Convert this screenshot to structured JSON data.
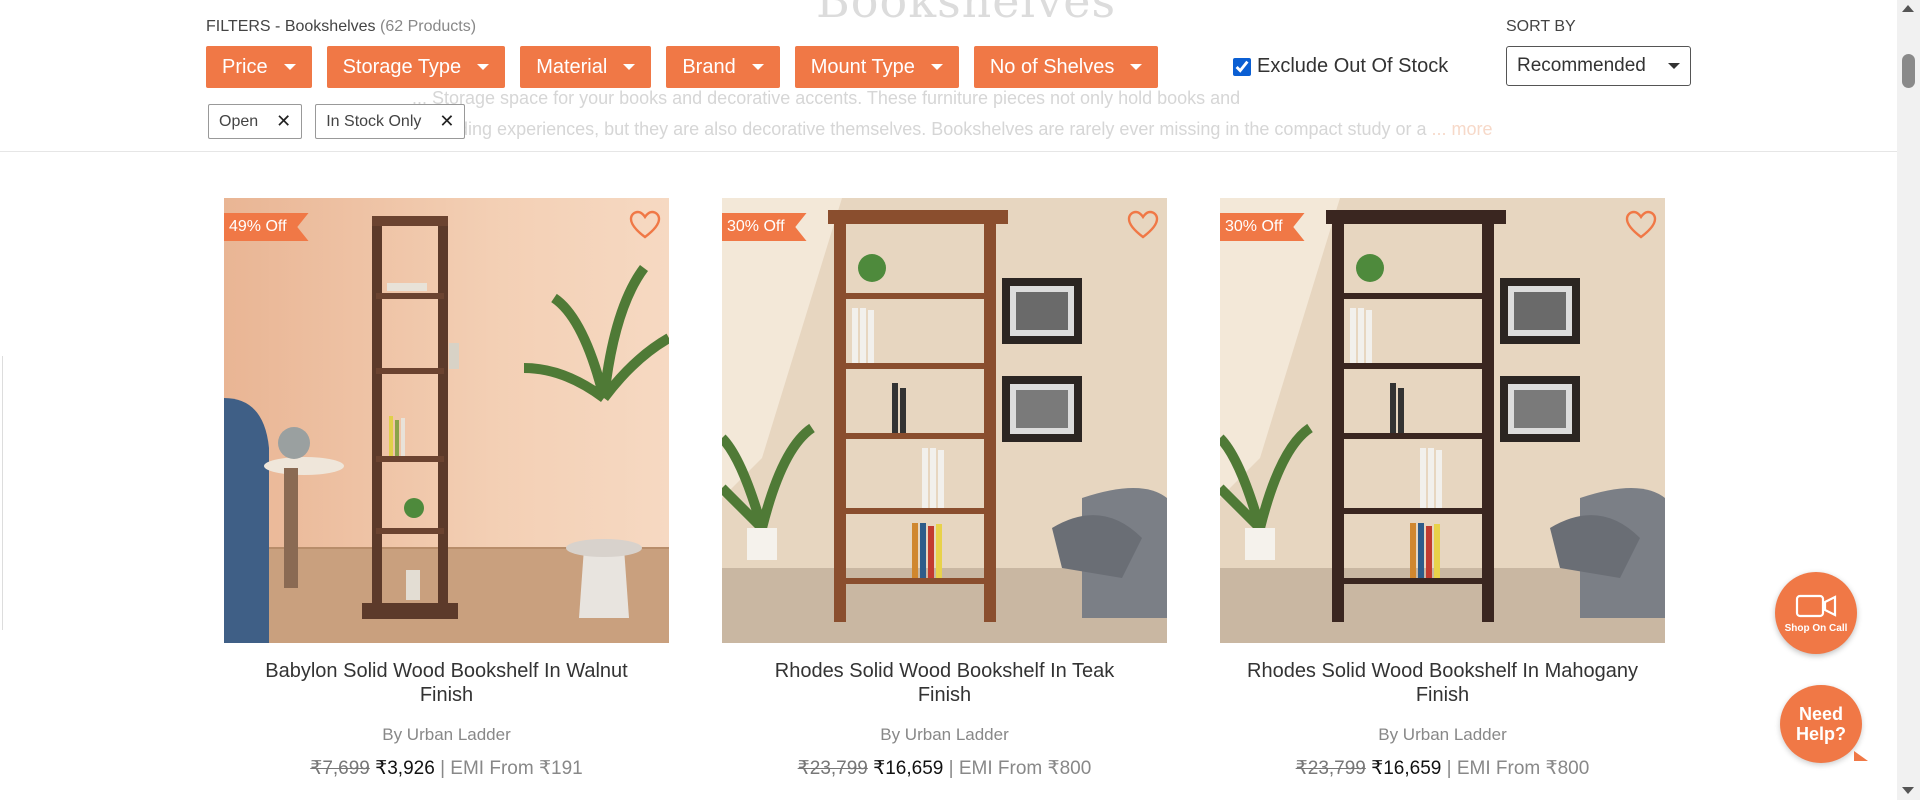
{
  "background": {
    "title": "Bookshelves",
    "description_line1": "... Storage space for your books and decorative accents. These furniture pieces not only hold books and",
    "description_line2": "... reading experiences, but they are also decorative themselves. Bookshelves are rarely ever missing in the compact study or a",
    "read_more": "... more"
  },
  "filters": {
    "heading": "FILTERS - Bookshelves",
    "count": "(62 Products)",
    "buttons": [
      "Price",
      "Storage Type",
      "Material",
      "Brand",
      "Mount Type",
      "No of Shelves"
    ],
    "exclude_out_of_stock": {
      "label": "Exclude Out Of Stock",
      "checked": true
    },
    "active_chips": [
      "Open",
      "In Stock Only"
    ]
  },
  "sort": {
    "label": "SORT BY",
    "value": "Recommended"
  },
  "products": [
    {
      "badge": "49% Off",
      "title": "Babylon Solid Wood Bookshelf In Walnut Finish",
      "brand": "By Urban Ladder",
      "mrp": "₹7,699",
      "price": "₹3,926",
      "emi": "| EMI From ₹191"
    },
    {
      "badge": "30% Off",
      "title": "Rhodes Solid Wood Bookshelf In Teak Finish",
      "brand": "By Urban Ladder",
      "mrp": "₹23,799",
      "price": "₹16,659",
      "emi": "| EMI From ₹800"
    },
    {
      "badge": "30% Off",
      "title": "Rhodes Solid Wood Bookshelf In Mahogany Finish",
      "brand": "By Urban Ladder",
      "mrp": "₹23,799",
      "price": "₹16,659",
      "emi": "| EMI From ₹800"
    }
  ],
  "widgets": {
    "shop_on_call": "Shop On Call",
    "need_help": "Need Help?"
  },
  "colors": {
    "accent": "#f07846",
    "checkbox": "#0b5fd3"
  },
  "icons": [
    "heart-icon",
    "video-call-icon",
    "close-icon",
    "chevron-down-icon"
  ]
}
